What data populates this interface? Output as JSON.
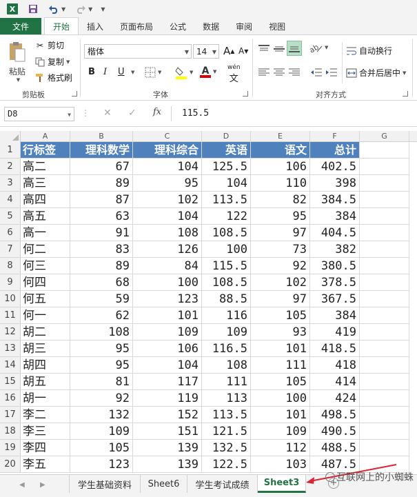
{
  "app": {
    "logo": "X",
    "colors": {
      "accent": "#217346",
      "header_fill": "#4f81bd"
    }
  },
  "tabs": [
    "文件",
    "开始",
    "插入",
    "页面布局",
    "公式",
    "数据",
    "审阅",
    "视图"
  ],
  "ribbon": {
    "clipboard": {
      "paste": "粘贴",
      "cut": "剪切",
      "copy": "复制",
      "format_painter": "格式刷",
      "group": "剪贴板"
    },
    "font": {
      "name": "楷体",
      "size": "14",
      "bold": "B",
      "italic": "I",
      "underline": "U",
      "wen": "wén",
      "group": "字体"
    },
    "alignment": {
      "wrap": "自动换行",
      "merge": "合并后居中",
      "group": "对齐方式"
    }
  },
  "formula_bar": {
    "name_box": "D8",
    "fx": "fx",
    "value": "115.5"
  },
  "columns": [
    "A",
    "B",
    "C",
    "D",
    "E",
    "F",
    "G"
  ],
  "header_row": [
    "行标签",
    "理科数学",
    "理科综合",
    "英语",
    "语文",
    "总计"
  ],
  "rows": [
    {
      "n": "2",
      "cells": [
        "高二",
        "67",
        "104",
        "125.5",
        "106",
        "402.5"
      ]
    },
    {
      "n": "3",
      "cells": [
        "高三",
        "89",
        "95",
        "104",
        "110",
        "398"
      ]
    },
    {
      "n": "4",
      "cells": [
        "高四",
        "87",
        "102",
        "113.5",
        "82",
        "384.5"
      ]
    },
    {
      "n": "5",
      "cells": [
        "高五",
        "63",
        "104",
        "122",
        "95",
        "384"
      ]
    },
    {
      "n": "6",
      "cells": [
        "高一",
        "91",
        "108",
        "108.5",
        "97",
        "404.5"
      ]
    },
    {
      "n": "7",
      "cells": [
        "何二",
        "83",
        "126",
        "100",
        "73",
        "382"
      ]
    },
    {
      "n": "8",
      "cells": [
        "何三",
        "89",
        "84",
        "115.5",
        "92",
        "380.5"
      ]
    },
    {
      "n": "9",
      "cells": [
        "何四",
        "68",
        "100",
        "108.5",
        "102",
        "378.5"
      ]
    },
    {
      "n": "10",
      "cells": [
        "何五",
        "59",
        "123",
        "88.5",
        "97",
        "367.5"
      ]
    },
    {
      "n": "11",
      "cells": [
        "何一",
        "62",
        "101",
        "116",
        "105",
        "384"
      ]
    },
    {
      "n": "12",
      "cells": [
        "胡二",
        "108",
        "109",
        "109",
        "93",
        "419"
      ]
    },
    {
      "n": "13",
      "cells": [
        "胡三",
        "95",
        "106",
        "116.5",
        "101",
        "418.5"
      ]
    },
    {
      "n": "14",
      "cells": [
        "胡四",
        "95",
        "104",
        "108",
        "111",
        "418"
      ]
    },
    {
      "n": "15",
      "cells": [
        "胡五",
        "81",
        "117",
        "111",
        "105",
        "414"
      ]
    },
    {
      "n": "16",
      "cells": [
        "胡一",
        "92",
        "119",
        "113",
        "100",
        "424"
      ]
    },
    {
      "n": "17",
      "cells": [
        "李二",
        "132",
        "152",
        "113.5",
        "101",
        "498.5"
      ]
    },
    {
      "n": "18",
      "cells": [
        "李三",
        "109",
        "151",
        "121.5",
        "109",
        "490.5"
      ]
    },
    {
      "n": "19",
      "cells": [
        "李四",
        "105",
        "139",
        "132.5",
        "112",
        "488.5"
      ]
    },
    {
      "n": "20",
      "cells": [
        "李五",
        "123",
        "139",
        "122.5",
        "103",
        "487.5"
      ]
    }
  ],
  "sheets": [
    "学生基础资料",
    "Sheet6",
    "学生考试成绩",
    "Sheet3"
  ],
  "active_sheet": "Sheet3",
  "watermark": "互联网上的小蜘蛛"
}
